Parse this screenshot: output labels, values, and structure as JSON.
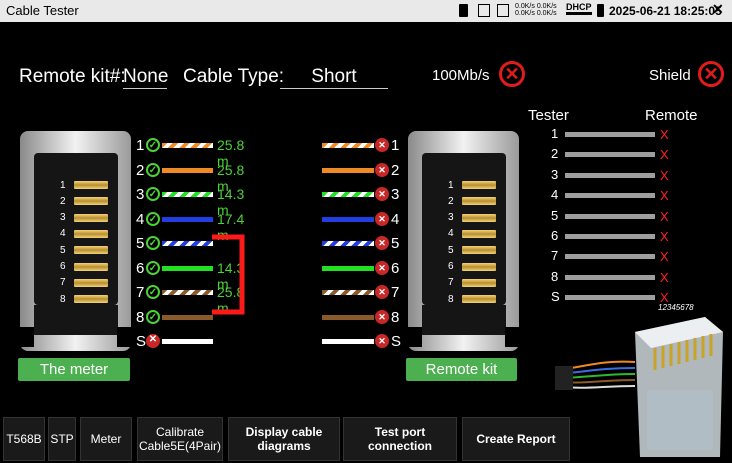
{
  "statusbar": {
    "title": "Cable Tester",
    "net_up": "0.0K/s",
    "net_down": "0.0K/s",
    "net_up2": "0.0K/s",
    "net_down2": "0.0K/s",
    "dhcp": "DHCP",
    "datetime": "2025-06-21 18:25:05"
  },
  "header": {
    "remote_kit_label": "Remote kit#:",
    "remote_kit_value": "None",
    "cable_type_label": "Cable Type:",
    "cable_type_value": "Short",
    "speed_label": "100Mb/s",
    "shield_label": "Shield"
  },
  "meter_label": "The meter",
  "remote_label": "Remote kit",
  "meter_pins": [
    "1",
    "2",
    "3",
    "4",
    "5",
    "6",
    "7",
    "8"
  ],
  "wires": [
    {
      "num": "1",
      "distance": "25.8 m",
      "status": "ok",
      "pattern": "white-orange"
    },
    {
      "num": "2",
      "distance": "25.8 m",
      "status": "ok",
      "pattern": "orange"
    },
    {
      "num": "3",
      "distance": "14.3 m",
      "status": "ok",
      "pattern": "white-green"
    },
    {
      "num": "4",
      "distance": "17.4 m",
      "status": "ok",
      "pattern": "blue"
    },
    {
      "num": "5",
      "distance": "",
      "status": "ok",
      "pattern": "white-blue"
    },
    {
      "num": "6",
      "distance": "14.3 m",
      "status": "ok",
      "pattern": "green"
    },
    {
      "num": "7",
      "distance": "25.8 m",
      "status": "ok",
      "pattern": "white-brown"
    },
    {
      "num": "8",
      "distance": "",
      "status": "ok",
      "pattern": "brown"
    },
    {
      "num": "S",
      "distance": "",
      "status": "fail",
      "pattern": "white"
    }
  ],
  "legend": {
    "tester_label": "Tester",
    "remote_label": "Remote",
    "rows": [
      {
        "num": "1",
        "remote": "X"
      },
      {
        "num": "2",
        "remote": "X"
      },
      {
        "num": "3",
        "remote": "X"
      },
      {
        "num": "4",
        "remote": "X"
      },
      {
        "num": "5",
        "remote": "X"
      },
      {
        "num": "6",
        "remote": "X"
      },
      {
        "num": "7",
        "remote": "X"
      },
      {
        "num": "8",
        "remote": "X"
      },
      {
        "num": "S",
        "remote": "X"
      }
    ]
  },
  "plug_label": "12345678",
  "bottom_buttons": [
    {
      "name": "t568b-button",
      "label": "T568B"
    },
    {
      "name": "stp-button",
      "label": "STP"
    },
    {
      "name": "meter-button",
      "label": "Meter"
    },
    {
      "name": "calibrate-button",
      "label": "Calibrate Cable5E(4Pair)"
    },
    {
      "name": "display-cable-diagrams-button",
      "label": "Display cable diagrams"
    },
    {
      "name": "test-port-connection-button",
      "label": "Test port connection"
    },
    {
      "name": "create-report-button",
      "label": "Create Report"
    }
  ],
  "colors": {
    "ok": "#4cd137",
    "fail": "#e21b1b",
    "button_green": "#4caf50"
  }
}
